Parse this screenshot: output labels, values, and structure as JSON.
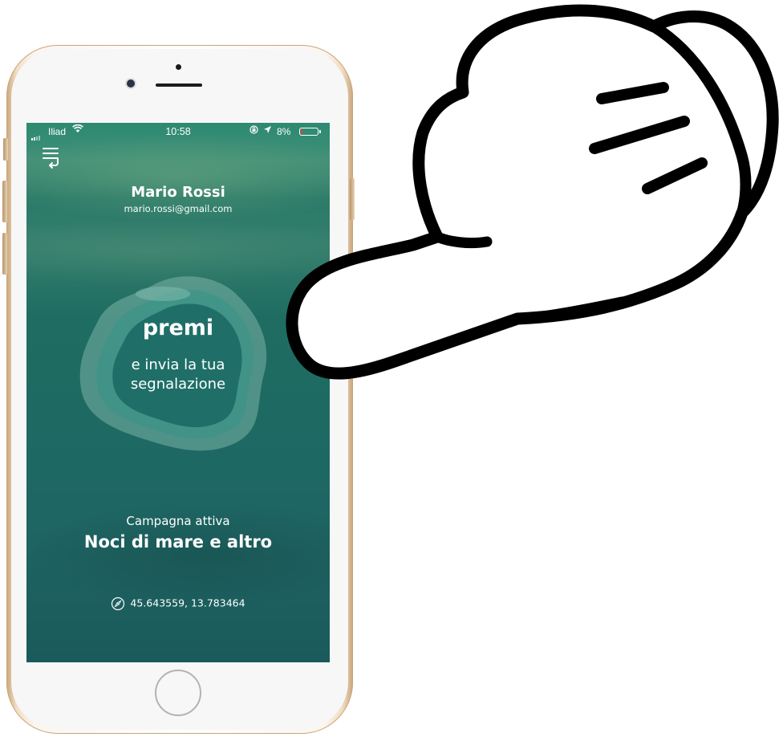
{
  "status_bar": {
    "carrier": "Iliad",
    "time": "10:58",
    "battery_percent": "8%",
    "battery_level": 0.08,
    "icons": [
      "signal-icon",
      "wifi-icon",
      "orientation-lock-icon",
      "location-arrow-icon",
      "battery-icon"
    ]
  },
  "header": {
    "menu_icon": "menu-icon"
  },
  "user": {
    "name": "Mario Rossi",
    "email": "mario.rossi@gmail.com"
  },
  "report_button": {
    "title": "premi",
    "subtitle_line1": "e invia la tua",
    "subtitle_line2": "segnalazione"
  },
  "campaign": {
    "label": "Campagna attiva",
    "name": "Noci di mare e altro"
  },
  "location": {
    "icon": "compass-icon",
    "coordinates": "45.643559, 13.783464"
  },
  "colors": {
    "screen_top": "#2d8a72",
    "screen_bottom": "#1a5a5a",
    "blob_light": "#6fb3a8",
    "blob_dark": "#1f6f68",
    "battery_low": "#ff3b30",
    "device_gold": "#c9a67b"
  }
}
